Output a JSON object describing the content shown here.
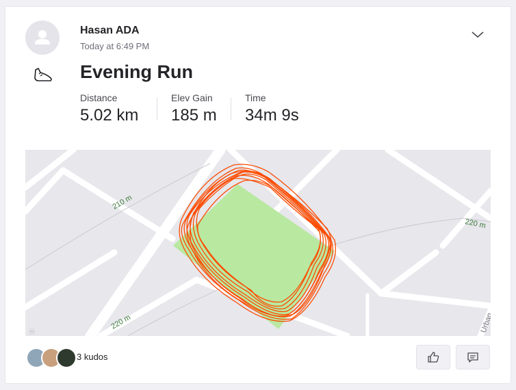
{
  "activity": {
    "athlete": "Hasan ADA",
    "timestamp": "Today at 6:49 PM",
    "title": "Evening Run",
    "sport_icon": "running-shoe-icon"
  },
  "stats": [
    {
      "label": "Distance",
      "value": "5.02 km"
    },
    {
      "label": "Elev Gain",
      "value": "185 m"
    },
    {
      "label": "Time",
      "value": "34m 9s"
    }
  ],
  "map": {
    "contour_labels": [
      "210 m",
      "220 m",
      "220 m"
    ],
    "road_label": "Urban",
    "route_color": "#fc4c02",
    "park_color": "#b9e8a0"
  },
  "kudos": {
    "text": "3 kudos",
    "count": 3
  },
  "actions": {
    "kudos_icon": "thumbs-up-icon",
    "comment_icon": "comment-icon"
  }
}
